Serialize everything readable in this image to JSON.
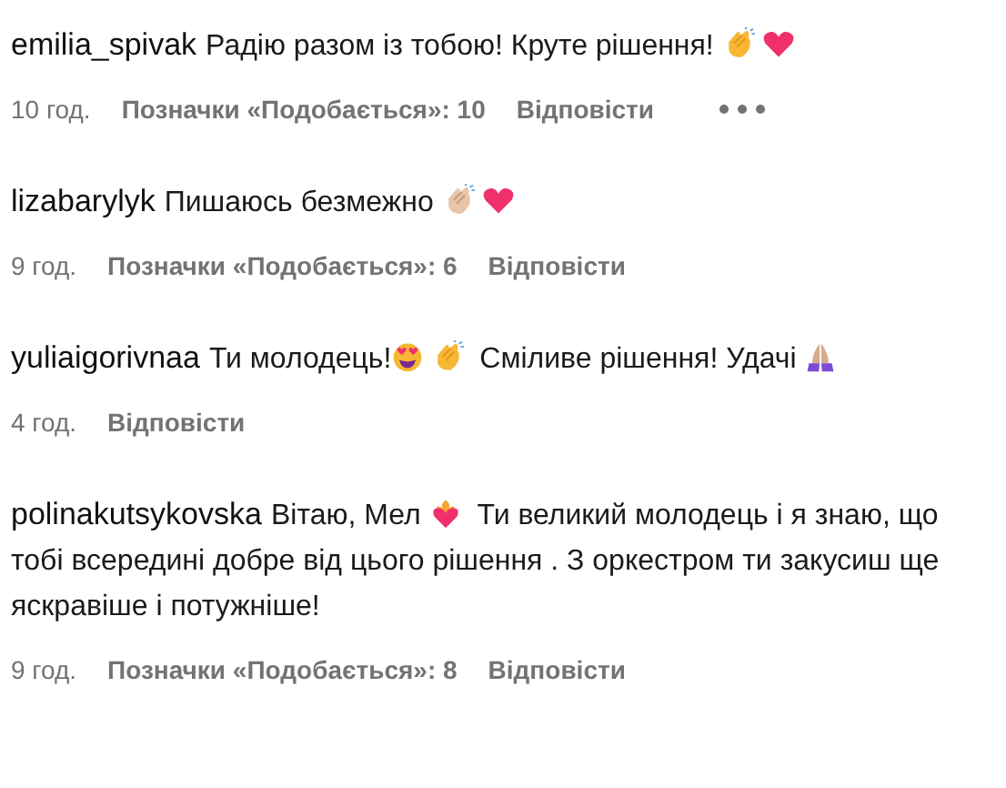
{
  "comments": [
    {
      "username": "emilia_spivak",
      "segments": [
        {
          "kind": "text",
          "text": "Радію разом із тобою! Круте рішення! "
        },
        {
          "kind": "clap"
        },
        {
          "kind": "heart"
        }
      ],
      "time": "10 год.",
      "likes": "Позначки «Подобається»: 10",
      "reply": "Відповісти",
      "more": true
    },
    {
      "username": "lizabarylyk",
      "segments": [
        {
          "kind": "text",
          "text": "Пишаюсь безмежно "
        },
        {
          "kind": "clap-light"
        },
        {
          "kind": "heart"
        }
      ],
      "time": "9 год.",
      "likes": "Позначки «Подобається»: 6",
      "reply": "Відповісти",
      "more": false
    },
    {
      "username": "yuliaigorivnaa",
      "segments": [
        {
          "kind": "text",
          "text": "Ти молодець!"
        },
        {
          "kind": "heart-eyes"
        },
        {
          "kind": "clap"
        },
        {
          "kind": "text",
          "text": " Сміливе рішення! Удачі "
        },
        {
          "kind": "praying"
        }
      ],
      "time": "4 год.",
      "reply": "Відповісти",
      "more": false
    },
    {
      "username": "polinakutsykovska",
      "segments": [
        {
          "kind": "text",
          "text": "Вітаю, Мел "
        },
        {
          "kind": "flaming-heart"
        },
        {
          "kind": "text",
          "text": " Ти великий молодець і я знаю, що тобі всередині добре від цього рішення . З оркестром ти закусиш ще яскравіше і потужніше!"
        }
      ],
      "time": "9 год.",
      "likes": "Позначки «Подобається»: 8",
      "reply": "Відповісти",
      "more": false
    }
  ]
}
